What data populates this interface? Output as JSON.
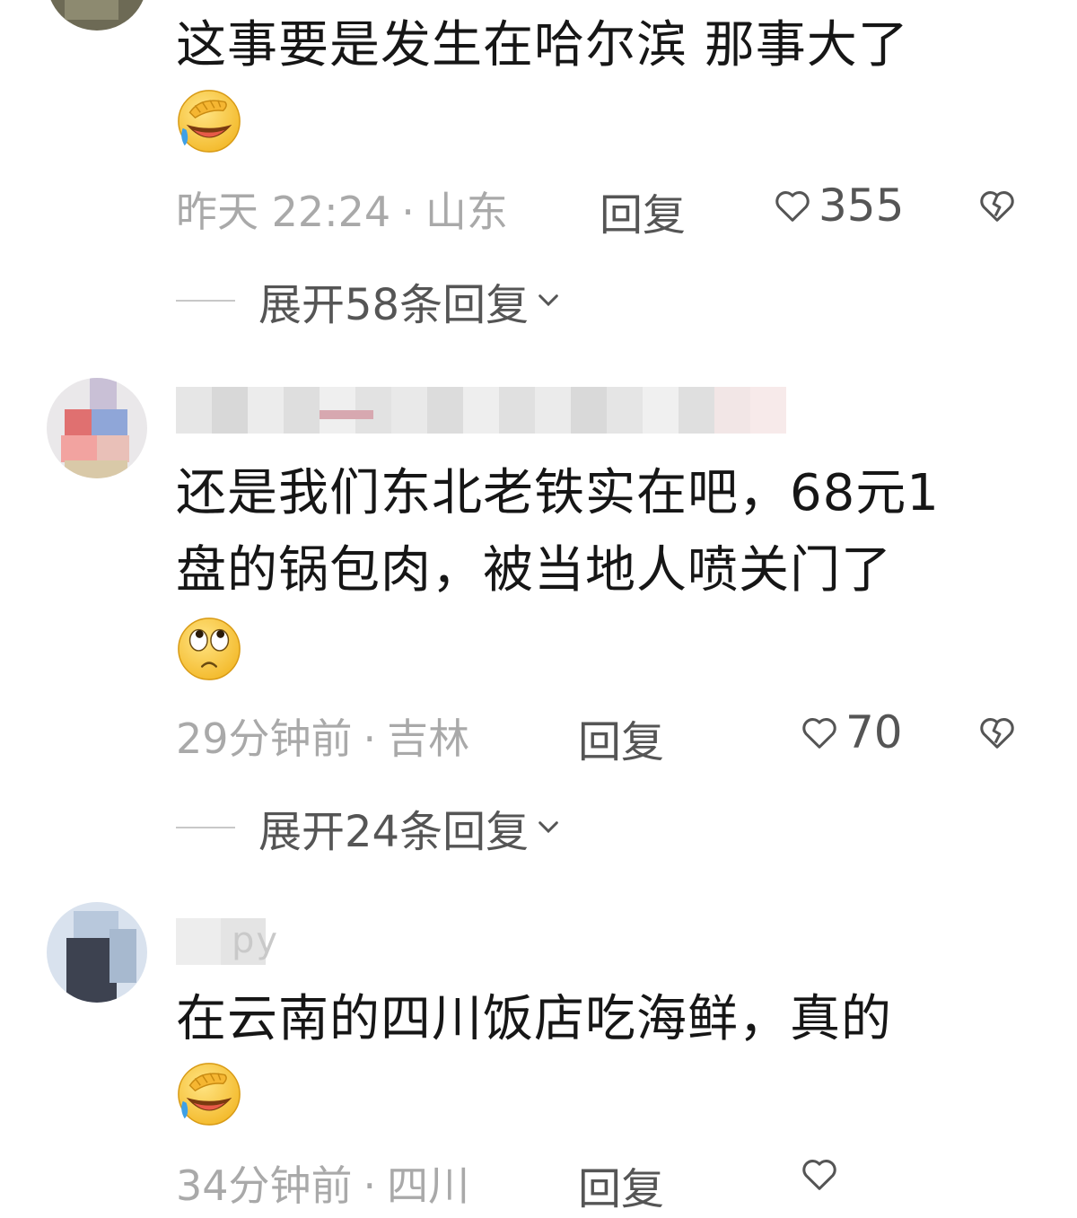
{
  "comments": [
    {
      "text_lines": [
        "这事要是发生在哈尔滨 那事大了"
      ],
      "emoji": "facepalm-laugh-emoji",
      "time": "昨天 22:24",
      "location": "山东",
      "reply_label": "回复",
      "likes": "355",
      "expand_label": "展开58条回复"
    },
    {
      "text_lines": [
        "还是我们东北老铁实在吧，68元1",
        "盘的锅包肉，被当地人喷关门了"
      ],
      "emoji": "eye-roll-emoji",
      "time": "29分钟前",
      "location": "吉林",
      "reply_label": "回复",
      "likes": "70",
      "expand_label": "展开24条回复"
    },
    {
      "username_tail": "py",
      "text_lines": [
        "在云南的四川饭店吃海鲜，真的"
      ],
      "emoji": "facepalm-laugh-emoji",
      "time": "34分钟前",
      "location": "四川",
      "reply_label": "回复"
    }
  ],
  "separator": "·",
  "colors": {
    "text": "#161616",
    "meta": "#a9a9a9",
    "action": "#555555",
    "emoji_yellow": "#f7c93b"
  }
}
